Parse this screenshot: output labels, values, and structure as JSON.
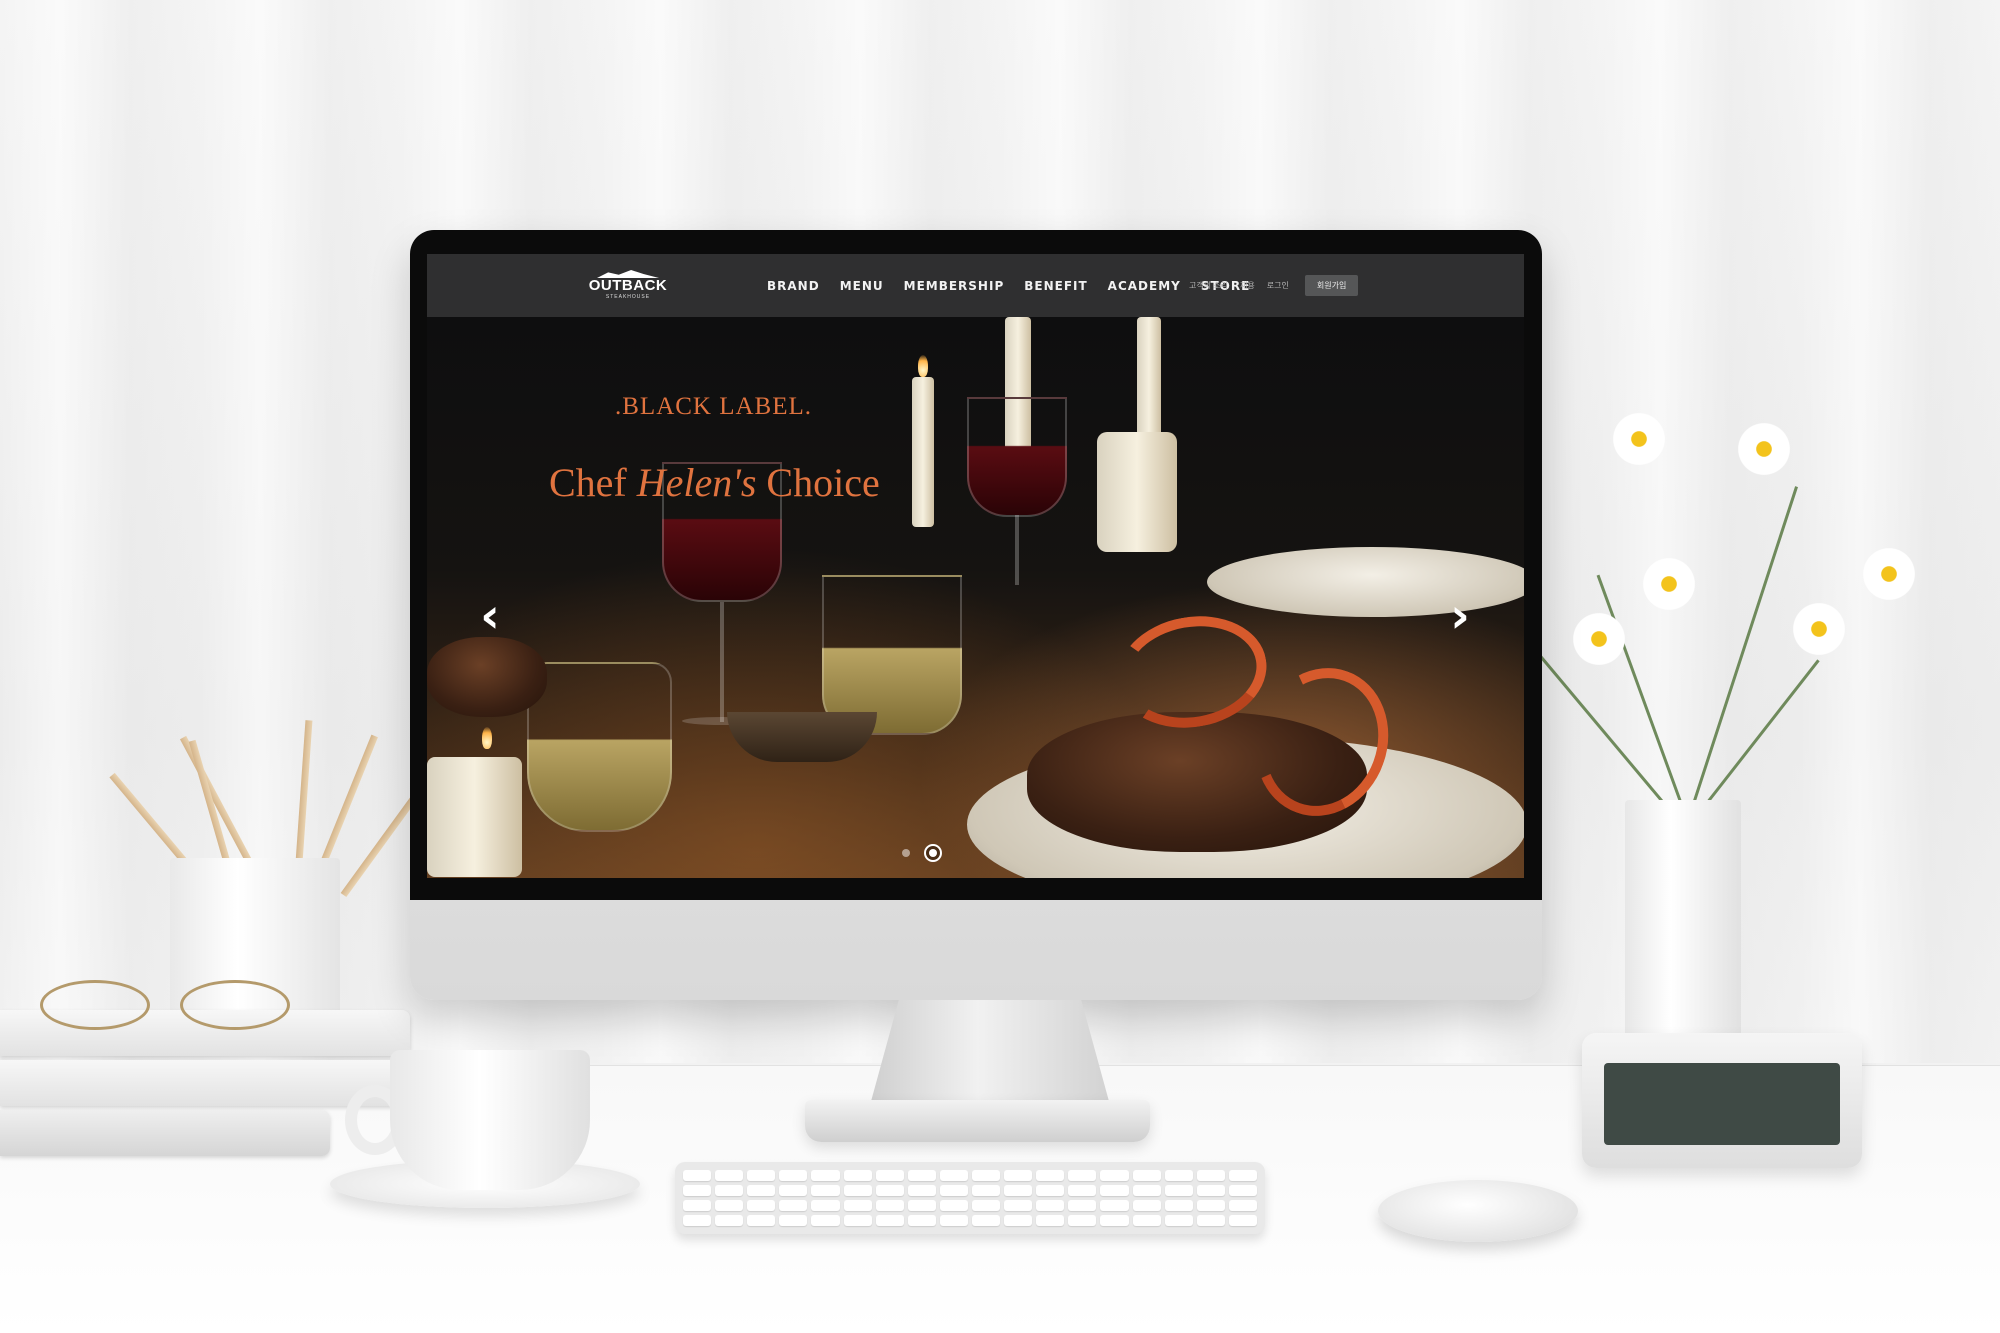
{
  "site": {
    "logo": {
      "main": "OUTBACK",
      "sub": "STEAKHOUSE"
    },
    "nav": [
      "BRAND",
      "MENU",
      "MEMBERSHIP",
      "BENEFIT",
      "ACADEMY",
      "STORE"
    ],
    "utility": {
      "voice": "고객의 소리",
      "recruit": "채용",
      "login": "로그인",
      "signup": "회원가입"
    },
    "hero": {
      "label": ".BLACK LABEL.",
      "title_part1": "Chef",
      "title_script": "Helen's",
      "title_part2": "Choice",
      "arrow_left": "‹",
      "arrow_right": "›",
      "slides": 2,
      "active_slide": 2
    }
  },
  "colors": {
    "header_bg": "#2f2f30",
    "accent": "#e0733f",
    "signup_bg": "#555657"
  }
}
